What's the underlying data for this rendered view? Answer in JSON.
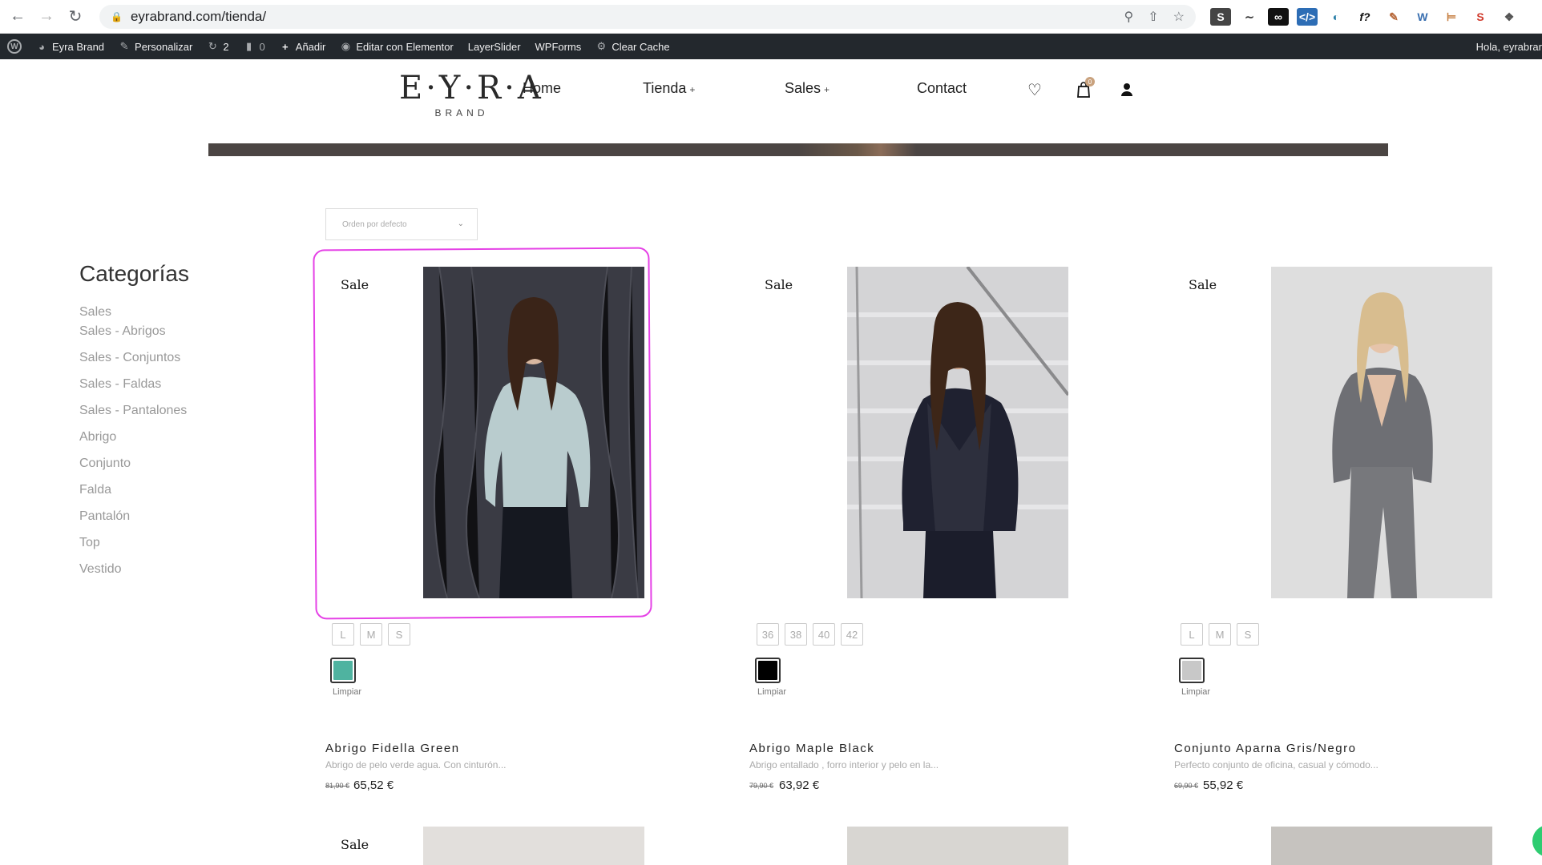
{
  "browser": {
    "url": "eyrabrand.com/tienda/"
  },
  "wp_bar": {
    "site_name": "Eyra Brand",
    "customize": "Personalizar",
    "updates_count": "2",
    "comments_count": "0",
    "add_new": "Añadir",
    "edit_elementor": "Editar con Elementor",
    "layerslider": "LayerSlider",
    "wpforms": "WPForms",
    "clear_cache": "Clear Cache",
    "greeting": "Hola, eyrabrar"
  },
  "header": {
    "logo_main": "E·Y·R·A",
    "logo_sub": "BRAND",
    "nav": {
      "home": "Home",
      "tienda": "Tienda",
      "sales": "Sales",
      "contact": "Contact"
    },
    "cart_count": "0"
  },
  "sort": {
    "selected": "Orden por defecto"
  },
  "sidebar": {
    "title": "Categorías",
    "items": [
      "Sales",
      "Sales - Abrigos",
      "Sales - Conjuntos",
      "Sales - Faldas",
      "Sales - Pantalones",
      "Abrigo",
      "Conjunto",
      "Falda",
      "Pantalón",
      "Top",
      "Vestido"
    ]
  },
  "sale_label": "Sale",
  "clear_label": "Limpiar",
  "products": [
    {
      "name": "Abrigo Fidella Green",
      "desc": "Abrigo de pelo verde agua. Con cinturón...",
      "old_price": "81,90 €",
      "price": "65,52 €",
      "sizes": [
        "L",
        "M",
        "S"
      ],
      "swatch_color": "#4fb3a0"
    },
    {
      "name": "Abrigo Maple Black",
      "desc": "Abrigo entallado , forro interior y pelo en la...",
      "old_price": "79,90 €",
      "price": "63,92 €",
      "sizes": [
        "36",
        "38",
        "40",
        "42"
      ],
      "swatch_color": "#000000"
    },
    {
      "name": "Conjunto Aparna Gris/Negro",
      "desc": "Perfecto conjunto de oficina, casual y cómodo...",
      "old_price": "69,90 €",
      "price": "55,92 €",
      "sizes": [
        "L",
        "M",
        "S"
      ],
      "swatch_color": "#c8c8c8"
    }
  ]
}
